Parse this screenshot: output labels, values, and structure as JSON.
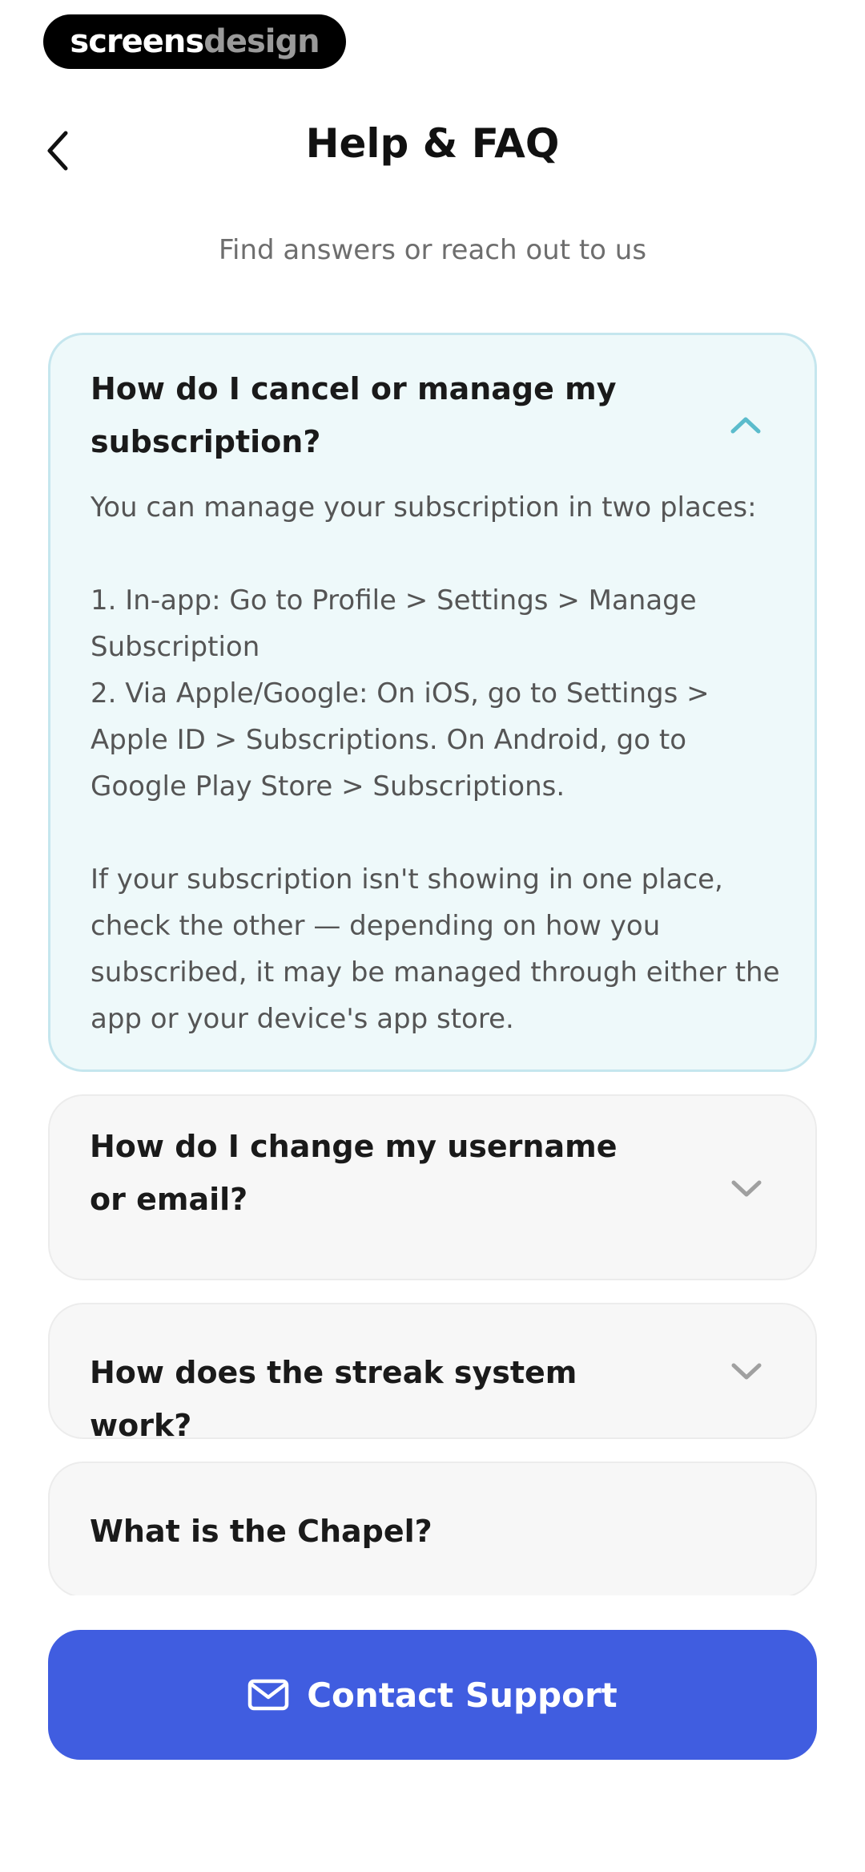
{
  "brand": {
    "part1": "screens",
    "part2": "design"
  },
  "header": {
    "title": "Help & FAQ",
    "back_icon": "chevron-left-icon"
  },
  "subtitle": "Find answers or reach out to us",
  "faqs": [
    {
      "question": "How do I cancel or manage my subscription?",
      "expanded": true,
      "answer": "You can manage your subscription in two places:\n\n1. In-app: Go to Profile > Settings > Manage Subscription\n2. Via Apple/Google: On iOS, go to Settings > Apple ID > Subscriptions. On Android, go to Google Play Store > Subscriptions.\n\nIf your subscription isn't showing in one place, check the other — depending on how you subscribed, it may be managed through either the app or your device's app store."
    },
    {
      "question": "How do I change my username or email?",
      "expanded": false
    },
    {
      "question": "How does the streak system work?",
      "expanded": false
    },
    {
      "question": "What is the Chapel?",
      "expanded": false
    }
  ],
  "contact": {
    "label": "Contact Support",
    "icon": "mail-icon"
  },
  "colors": {
    "accent": "#405de0",
    "expanded_bg": "#eef9fa",
    "expanded_border": "#c5e6ee",
    "chevron_open": "#5bbccc",
    "chevron_closed": "#a0a0a0"
  }
}
